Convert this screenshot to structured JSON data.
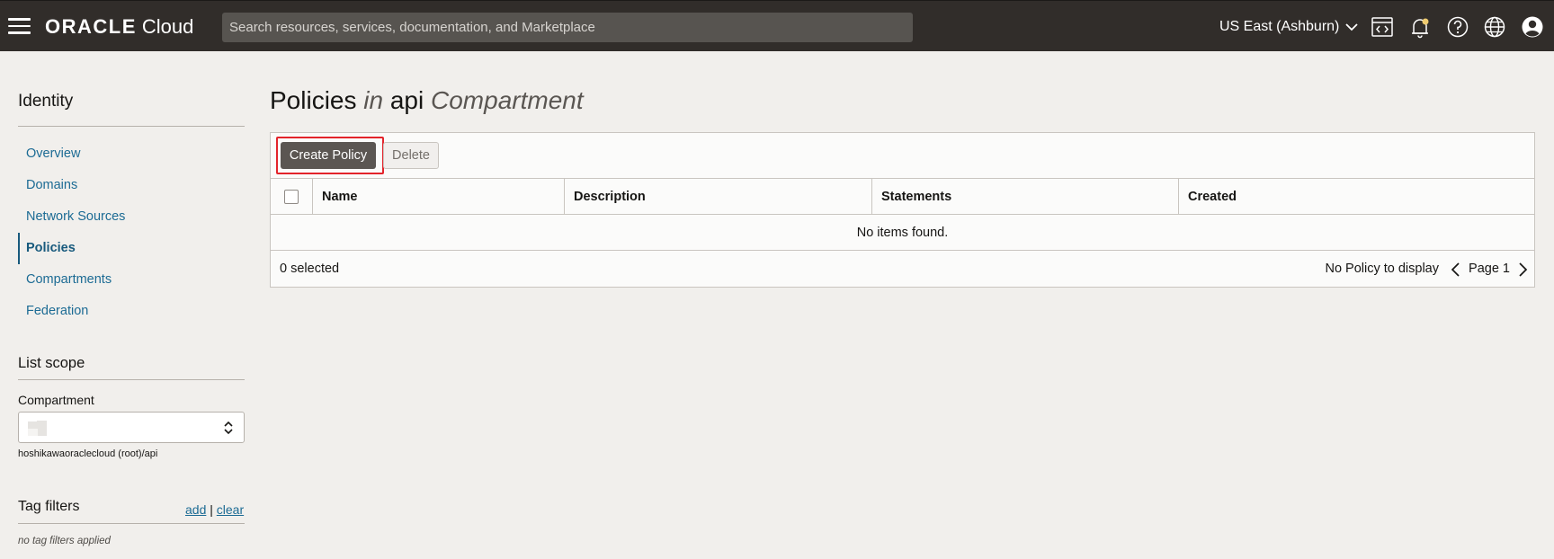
{
  "header": {
    "logo_oracle": "ORACLE",
    "logo_cloud": "Cloud",
    "search_placeholder": "Search resources, services, documentation, and Marketplace",
    "region": "US East (Ashburn)",
    "icons": [
      "menu-icon",
      "code-editor-icon",
      "notification-bell-icon",
      "help-icon",
      "language-globe-icon",
      "user-profile-icon"
    ],
    "notification_dot_color": "#f0cc71"
  },
  "sidebar": {
    "title": "Identity",
    "items": [
      {
        "label": "Overview"
      },
      {
        "label": "Domains"
      },
      {
        "label": "Network Sources"
      },
      {
        "label": "Policies",
        "active": true
      },
      {
        "label": "Compartments"
      },
      {
        "label": "Federation"
      }
    ],
    "list_scope_title": "List scope",
    "compartment_label": "Compartment",
    "compartment_path": "hoshikawaoraclecloud (root)/api",
    "tag_filters_title": "Tag filters",
    "tag_add": "add",
    "tag_separator": "|",
    "tag_clear": "clear",
    "tag_empty": "no tag filters applied"
  },
  "main": {
    "title_prefix": "Policies",
    "title_in": "in",
    "title_compartment": "api",
    "title_suffix": "Compartment",
    "create_button": "Create Policy",
    "delete_button": "Delete",
    "columns": [
      "Name",
      "Description",
      "Statements",
      "Created"
    ],
    "empty_message": "No items found.",
    "selected_count": "0 selected",
    "no_display": "No Policy to display",
    "page_label": "Page 1"
  },
  "colors": {
    "topbar": "#312d2a",
    "link": "#1c6b94",
    "primary_button": "#5b5652",
    "highlight_box": "#e3242b"
  }
}
